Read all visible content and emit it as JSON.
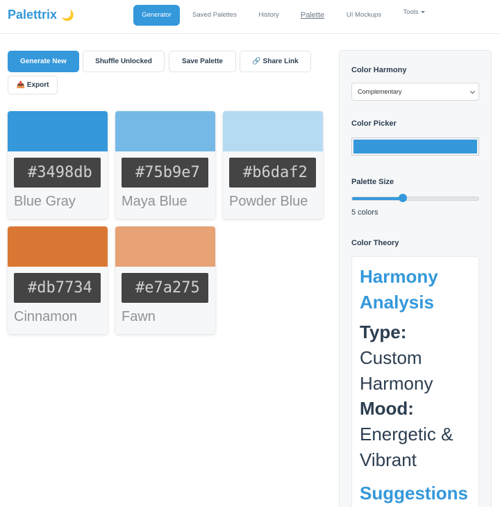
{
  "app": {
    "brand": "Palettrix",
    "theme_icon": "moon-icon"
  },
  "nav": {
    "items": [
      {
        "label": "Generator",
        "active": true
      },
      {
        "label": "Saved Palettes"
      },
      {
        "label": "History"
      },
      {
        "label": "Palette"
      },
      {
        "label": "UI Mockups"
      },
      {
        "label": "Tools"
      }
    ]
  },
  "toolbar": {
    "generate": "Generate New",
    "shuffle": "Shuffle Unlocked",
    "save": "Save Palette",
    "share": "🔗 Share Link",
    "export": "📤 Export"
  },
  "palette": [
    {
      "hex": "#3498db",
      "name": "Blue Gray",
      "color": "#3498db"
    },
    {
      "hex": "#75b9e7",
      "name": "Maya Blue",
      "color": "#75b9e7"
    },
    {
      "hex": "#b6daf2",
      "name": "Powder Blue",
      "color": "#b6daf2"
    },
    {
      "hex": "#db7734",
      "name": "Cinnamon",
      "color": "#db7734"
    },
    {
      "hex": "#e7a275",
      "name": "Fawn",
      "color": "#e7a275"
    }
  ],
  "sidebar": {
    "harmony_label": "Color Harmony",
    "harmony_value": "Complementary",
    "picker_label": "Color Picker",
    "picker_color": "#3498db",
    "size_label": "Palette Size",
    "size_value_fraction": 0.4,
    "size_text": "5 colors",
    "theory_label": "Color Theory",
    "theory": {
      "title": "Harmony Analysis",
      "type_label": "Type:",
      "type_value_1": "Custom",
      "type_value_2": "Harmony",
      "mood_label": "Mood:",
      "mood_value_1": "Energetic &",
      "mood_value_2": "Vibrant",
      "suggestions": "Suggestions"
    }
  }
}
